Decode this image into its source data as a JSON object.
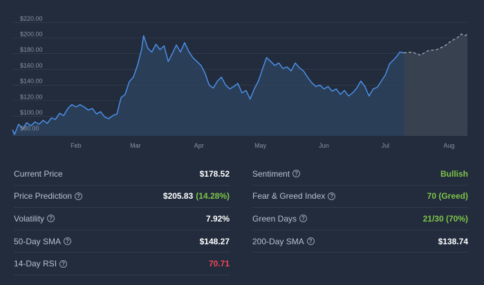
{
  "chart_data": {
    "type": "line",
    "y_ticks": [
      "$80.00",
      "$100.00",
      "$120.00",
      "$140.00",
      "$160.00",
      "$180.00",
      "$200.00",
      "$220.00"
    ],
    "y_tick_values": [
      80,
      100,
      120,
      140,
      160,
      180,
      200,
      220
    ],
    "ylim": [
      75,
      222
    ],
    "x_labels": [
      "Feb",
      "Mar",
      "Apr",
      "May",
      "Jun",
      "Jul",
      "Aug"
    ],
    "x_label_dates": [
      "2024-02-01",
      "2024-03-01",
      "2024-04-01",
      "2024-05-01",
      "2024-06-01",
      "2024-07-01",
      "2024-08-01"
    ],
    "xlim": [
      "2024-01-01",
      "2024-08-10"
    ],
    "grid": true,
    "series": [
      {
        "values": [
          [
            "2024-01-01",
            83
          ],
          [
            "2024-01-02",
            77
          ],
          [
            "2024-01-04",
            90
          ],
          [
            "2024-01-06",
            84
          ],
          [
            "2024-01-08",
            92
          ],
          [
            "2024-01-10",
            88
          ],
          [
            "2024-01-12",
            93
          ],
          [
            "2024-01-14",
            90
          ],
          [
            "2024-01-16",
            95
          ],
          [
            "2024-01-18",
            91
          ],
          [
            "2024-01-20",
            98
          ],
          [
            "2024-01-22",
            96
          ],
          [
            "2024-01-24",
            104
          ],
          [
            "2024-01-26",
            101
          ],
          [
            "2024-01-28",
            110
          ],
          [
            "2024-01-30",
            115
          ],
          [
            "2024-02-01",
            112
          ],
          [
            "2024-02-03",
            115
          ],
          [
            "2024-02-05",
            112
          ],
          [
            "2024-02-07",
            108
          ],
          [
            "2024-02-09",
            110
          ],
          [
            "2024-02-11",
            103
          ],
          [
            "2024-02-13",
            106
          ],
          [
            "2024-02-15",
            99
          ],
          [
            "2024-02-17",
            97
          ],
          [
            "2024-02-19",
            101
          ],
          [
            "2024-02-21",
            103
          ],
          [
            "2024-02-23",
            124
          ],
          [
            "2024-02-25",
            128
          ],
          [
            "2024-02-27",
            144
          ],
          [
            "2024-02-29",
            150
          ],
          [
            "2024-03-02",
            165
          ],
          [
            "2024-03-04",
            185
          ],
          [
            "2024-03-05",
            203
          ],
          [
            "2024-03-07",
            187
          ],
          [
            "2024-03-09",
            182
          ],
          [
            "2024-03-11",
            192
          ],
          [
            "2024-03-13",
            185
          ],
          [
            "2024-03-15",
            190
          ],
          [
            "2024-03-17",
            170
          ],
          [
            "2024-03-19",
            180
          ],
          [
            "2024-03-21",
            191
          ],
          [
            "2024-03-23",
            182
          ],
          [
            "2024-03-25",
            194
          ],
          [
            "2024-03-27",
            183
          ],
          [
            "2024-03-29",
            175
          ],
          [
            "2024-03-31",
            170
          ],
          [
            "2024-04-02",
            165
          ],
          [
            "2024-04-04",
            155
          ],
          [
            "2024-04-06",
            140
          ],
          [
            "2024-04-08",
            136
          ],
          [
            "2024-04-10",
            145
          ],
          [
            "2024-04-12",
            150
          ],
          [
            "2024-04-14",
            140
          ],
          [
            "2024-04-16",
            135
          ],
          [
            "2024-04-18",
            138
          ],
          [
            "2024-04-20",
            142
          ],
          [
            "2024-04-22",
            130
          ],
          [
            "2024-04-24",
            133
          ],
          [
            "2024-04-26",
            122
          ],
          [
            "2024-04-28",
            135
          ],
          [
            "2024-04-30",
            145
          ],
          [
            "2024-05-02",
            160
          ],
          [
            "2024-05-04",
            175
          ],
          [
            "2024-05-06",
            170
          ],
          [
            "2024-05-08",
            165
          ],
          [
            "2024-05-10",
            168
          ],
          [
            "2024-05-12",
            161
          ],
          [
            "2024-05-14",
            163
          ],
          [
            "2024-05-16",
            158
          ],
          [
            "2024-05-18",
            168
          ],
          [
            "2024-05-20",
            162
          ],
          [
            "2024-05-22",
            158
          ],
          [
            "2024-05-24",
            150
          ],
          [
            "2024-05-26",
            143
          ],
          [
            "2024-05-28",
            138
          ],
          [
            "2024-05-30",
            140
          ],
          [
            "2024-06-01",
            135
          ],
          [
            "2024-06-03",
            138
          ],
          [
            "2024-06-05",
            132
          ],
          [
            "2024-06-07",
            135
          ],
          [
            "2024-06-09",
            128
          ],
          [
            "2024-06-11",
            133
          ],
          [
            "2024-06-13",
            126
          ],
          [
            "2024-06-15",
            130
          ],
          [
            "2024-06-17",
            136
          ],
          [
            "2024-06-19",
            145
          ],
          [
            "2024-06-21",
            138
          ],
          [
            "2024-06-23",
            126
          ],
          [
            "2024-06-25",
            135
          ],
          [
            "2024-06-27",
            137
          ],
          [
            "2024-06-29",
            145
          ],
          [
            "2024-07-01",
            153
          ],
          [
            "2024-07-03",
            167
          ],
          [
            "2024-07-05",
            172
          ],
          [
            "2024-07-07",
            178
          ],
          [
            "2024-07-08",
            182
          ],
          [
            "2024-07-10",
            181
          ]
        ]
      },
      {
        "style": "dashed",
        "values": [
          [
            "2024-07-10",
            181
          ],
          [
            "2024-07-14",
            182
          ],
          [
            "2024-07-18",
            178
          ],
          [
            "2024-07-22",
            184
          ],
          [
            "2024-07-26",
            185
          ],
          [
            "2024-07-30",
            190
          ],
          [
            "2024-08-02",
            196
          ],
          [
            "2024-08-05",
            200
          ],
          [
            "2024-08-07",
            205
          ],
          [
            "2024-08-09",
            203
          ],
          [
            "2024-08-10",
            205
          ]
        ]
      }
    ],
    "colors": {
      "line": "#4b8fe8",
      "area": "#2e4462",
      "forecast_line": "#aeb5c0",
      "forecast_area": "#3a4452",
      "grid": "#3a4352",
      "tick_text": "#8a93a2"
    }
  },
  "stats": {
    "left": [
      {
        "label": "Current Price",
        "value": "$178.52",
        "help": false,
        "tone": "white"
      },
      {
        "label": "Price Prediction",
        "value": "$205.83",
        "extra": "(14.28%)",
        "help": true,
        "tone": "white"
      },
      {
        "label": "Volatility",
        "value": "7.92%",
        "help": true,
        "tone": "white"
      },
      {
        "label": "50-Day SMA",
        "value": "$148.27",
        "help": true,
        "tone": "white"
      },
      {
        "label": "14-Day RSI",
        "value": "70.71",
        "help": true,
        "tone": "red"
      }
    ],
    "right": [
      {
        "label": "Sentiment",
        "value": "Bullish",
        "help": true,
        "tone": "green"
      },
      {
        "label": "Fear & Greed Index",
        "value": "70 (Greed)",
        "help": true,
        "tone": "green"
      },
      {
        "label": "Green Days",
        "value": "21/30 (70%)",
        "help": true,
        "tone": "green"
      },
      {
        "label": "200-Day SMA",
        "value": "$138.74",
        "help": true,
        "tone": "white"
      }
    ],
    "help_glyph": "?"
  }
}
